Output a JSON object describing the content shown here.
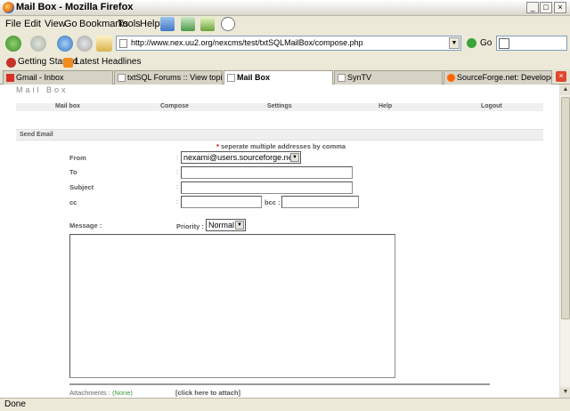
{
  "window": {
    "title": "Mail Box - Mozilla Firefox",
    "controls": {
      "minimize": "_",
      "maximize": "□",
      "close": "×"
    }
  },
  "menu": [
    "File",
    "Edit",
    "View",
    "Go",
    "Bookmarks",
    "Tools",
    "Help"
  ],
  "navigation": {
    "url": "http://www.nex.uu2.org/nexcms/test/txtSQLMailBox/compose.php",
    "go_label": "Go"
  },
  "bookmarks": [
    "Getting Started",
    "Latest Headlines"
  ],
  "tabs": [
    {
      "label": "Gmail - Inbox",
      "active": false
    },
    {
      "label": "txtSQL Forums :: View topic - txt...",
      "active": false
    },
    {
      "label": "Mail Box",
      "active": true
    },
    {
      "label": "SynTV",
      "active": false
    },
    {
      "label": "SourceForge.net: Developer Pr...",
      "active": false
    }
  ],
  "page": {
    "logo": "Mail Box",
    "nav": [
      "Mail box",
      "Compose",
      "Settings",
      "Help",
      "Logout"
    ],
    "section_title": "Send Email",
    "hint_star": "*",
    "hint_text": "seperate multiple addresses by comma",
    "form": {
      "from_label": "From",
      "from_value": "nexami@users.sourceforge.net",
      "to_label": "To",
      "subject_label": "Subject",
      "cc_label": "cc",
      "bcc_label": "bcc :",
      "colon": ":",
      "message_label": "Message :",
      "priority_label": "Priority :",
      "priority_value": "Normal",
      "attachments_label": "Attachments :",
      "attachments_value": "(None)",
      "attach_link": "[click here to attach]"
    }
  },
  "status": "Done"
}
